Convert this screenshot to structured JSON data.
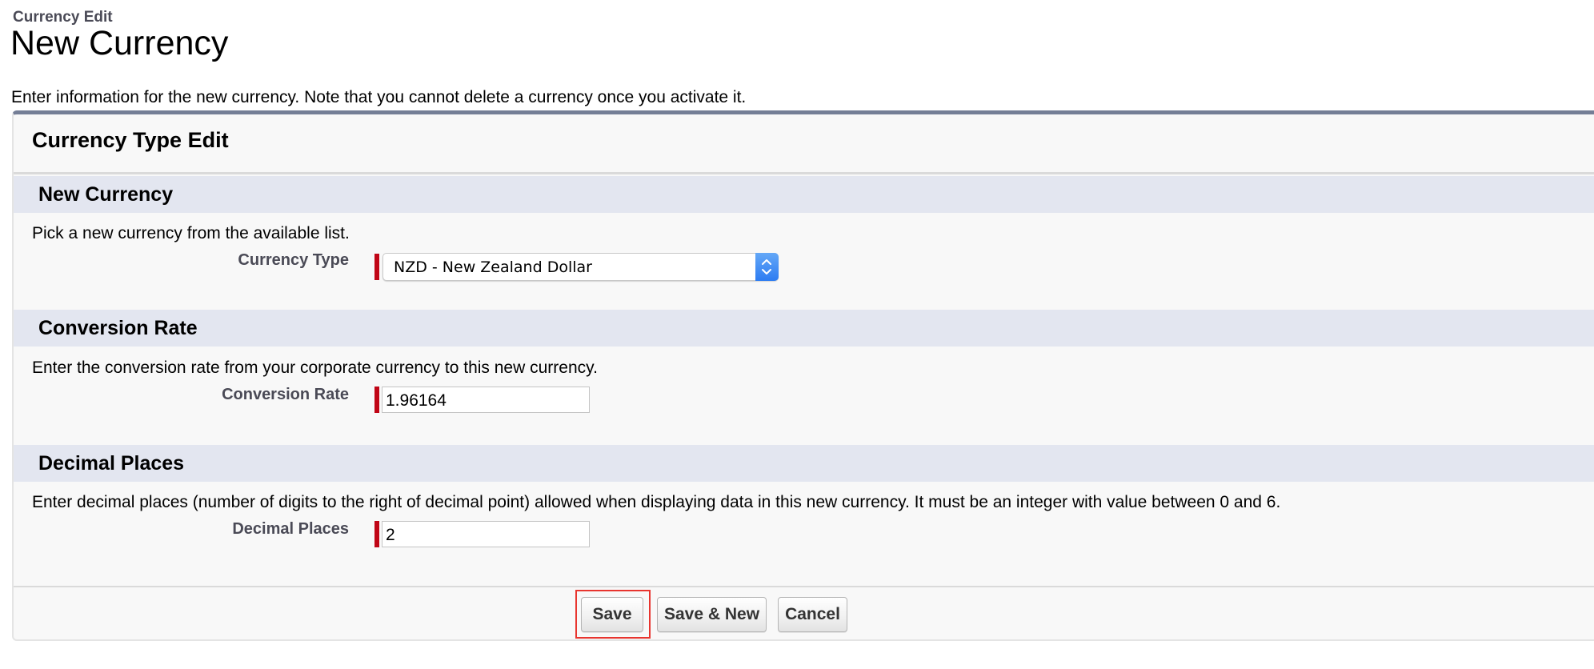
{
  "header": {
    "page_type": "Currency Edit",
    "title": "New Currency",
    "description": "Enter information for the new currency. Note that you cannot delete a currency once you activate it."
  },
  "panel": {
    "title": "Currency Type Edit",
    "sections": [
      {
        "heading": "New Currency",
        "description": "Pick a new currency from the available list.",
        "field": {
          "label": "Currency Type",
          "type": "select",
          "value": "NZD - New Zealand Dollar",
          "required": true
        }
      },
      {
        "heading": "Conversion Rate",
        "description": "Enter the conversion rate from your corporate currency to this new currency.",
        "field": {
          "label": "Conversion Rate",
          "type": "text",
          "value": "1.96164",
          "required": true
        }
      },
      {
        "heading": "Decimal Places",
        "description": "Enter decimal places (number of digits to the right of decimal point) allowed when displaying data in this new currency. It must be an integer with value between 0 and 6.",
        "field": {
          "label": "Decimal Places",
          "type": "text",
          "value": "2",
          "required": true
        }
      }
    ],
    "buttons": {
      "save": "Save",
      "save_new": "Save & New",
      "cancel": "Cancel"
    },
    "highlighted_button": "save"
  },
  "colors": {
    "panel_top_border": "#747e96",
    "section_header_bg": "#e3e6f0",
    "required_marker": "#c00516",
    "highlight_outline": "#e8352f",
    "select_stepper": "#2d7cf2"
  }
}
